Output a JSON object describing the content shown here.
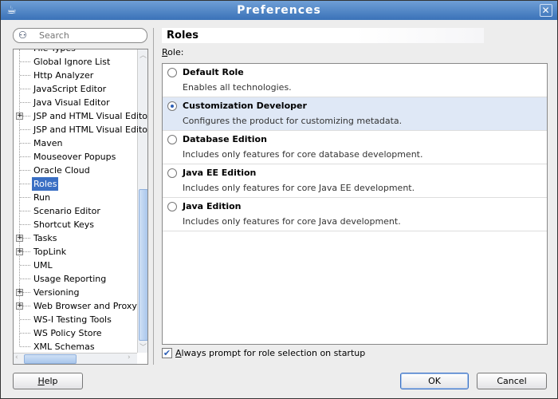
{
  "window": {
    "title": "Preferences",
    "icon": "coffee-cup-icon"
  },
  "search": {
    "placeholder": "Search",
    "icon": "binoculars-icon"
  },
  "tree": {
    "items": [
      {
        "label": "File Types",
        "expandable": false
      },
      {
        "label": "Global Ignore List",
        "expandable": false
      },
      {
        "label": "Http Analyzer",
        "expandable": false
      },
      {
        "label": "JavaScript Editor",
        "expandable": false
      },
      {
        "label": "Java Visual Editor",
        "expandable": false
      },
      {
        "label": "JSP and HTML Visual Edito",
        "expandable": true
      },
      {
        "label": "JSP and HTML Visual Edito",
        "expandable": false
      },
      {
        "label": "Maven",
        "expandable": false
      },
      {
        "label": "Mouseover Popups",
        "expandable": false
      },
      {
        "label": "Oracle Cloud",
        "expandable": false
      },
      {
        "label": "Roles",
        "expandable": false,
        "selected": true
      },
      {
        "label": "Run",
        "expandable": false
      },
      {
        "label": "Scenario Editor",
        "expandable": false
      },
      {
        "label": "Shortcut Keys",
        "expandable": false
      },
      {
        "label": "Tasks",
        "expandable": true
      },
      {
        "label": "TopLink",
        "expandable": true
      },
      {
        "label": "UML",
        "expandable": false
      },
      {
        "label": "Usage Reporting",
        "expandable": false
      },
      {
        "label": "Versioning",
        "expandable": true
      },
      {
        "label": "Web Browser and Proxy",
        "expandable": true
      },
      {
        "label": "WS-I Testing Tools",
        "expandable": false
      },
      {
        "label": "WS Policy Store",
        "expandable": false
      },
      {
        "label": "XML Schemas",
        "expandable": false
      }
    ]
  },
  "panel": {
    "title": "Roles",
    "role_label_mnemonic": "R",
    "role_label_rest": "ole:",
    "roles": [
      {
        "name": "Default Role",
        "description": "Enables all technologies.",
        "selected": false
      },
      {
        "name": "Customization Developer",
        "description": "Configures the product for customizing metadata.",
        "selected": true
      },
      {
        "name": "Database Edition",
        "description": "Includes only features for core database development.",
        "selected": false
      },
      {
        "name": "Java EE Edition",
        "description": "Includes only features for core Java EE development.",
        "selected": false
      },
      {
        "name": "Java Edition",
        "description": "Includes only features for core Java development.",
        "selected": false
      }
    ],
    "always_prompt": {
      "mnemonic": "A",
      "rest": "lways prompt for role selection on startup",
      "checked": true
    }
  },
  "buttons": {
    "help_mn": "H",
    "help_rest": "elp",
    "ok": "OK",
    "cancel": "Cancel"
  },
  "colors": {
    "selection": "#3a6fc4",
    "title_bar": "#3a72b8",
    "selected_row": "#dfe8f6"
  }
}
